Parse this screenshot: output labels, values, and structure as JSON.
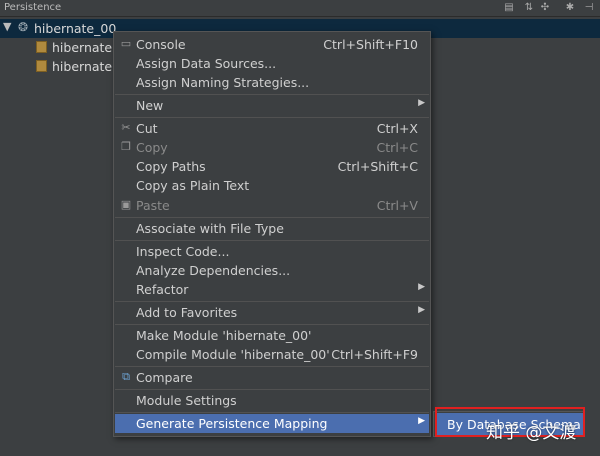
{
  "panel": {
    "title": "Persistence"
  },
  "toolbar": {
    "icons": [
      "layout-icon",
      "collapse-icon",
      "settings-icon",
      "hide-icon"
    ]
  },
  "tree": {
    "root": "hibernate_00",
    "children": [
      "hibernate.c",
      "hibernate.c"
    ]
  },
  "menu": {
    "items": [
      {
        "label": "Console",
        "shortcut": "Ctrl+Shift+F10"
      },
      {
        "label": "Assign Data Sources...",
        "shortcut": ""
      },
      {
        "label": "Assign Naming Strategies...",
        "shortcut": ""
      },
      {
        "label": "New",
        "shortcut": ""
      },
      {
        "label": "Cut",
        "shortcut": "Ctrl+X"
      },
      {
        "label": "Copy",
        "shortcut": "Ctrl+C"
      },
      {
        "label": "Copy Paths",
        "shortcut": "Ctrl+Shift+C"
      },
      {
        "label": "Copy as Plain Text",
        "shortcut": ""
      },
      {
        "label": "Paste",
        "shortcut": "Ctrl+V"
      },
      {
        "label": "Associate with File Type",
        "shortcut": ""
      },
      {
        "label": "Inspect Code...",
        "shortcut": ""
      },
      {
        "label": "Analyze Dependencies...",
        "shortcut": ""
      },
      {
        "label": "Refactor",
        "shortcut": ""
      },
      {
        "label": "Add to Favorites",
        "shortcut": ""
      },
      {
        "label": "Make Module 'hibernate_00'",
        "shortcut": ""
      },
      {
        "label": "Compile Module 'hibernate_00'",
        "shortcut": "Ctrl+Shift+F9"
      },
      {
        "label": "Compare",
        "shortcut": ""
      },
      {
        "label": "Module Settings",
        "shortcut": ""
      },
      {
        "label": "Generate Persistence Mapping",
        "shortcut": ""
      }
    ]
  },
  "submenu": {
    "item": "By Database Schema"
  },
  "watermark": "知乎 @文渡"
}
